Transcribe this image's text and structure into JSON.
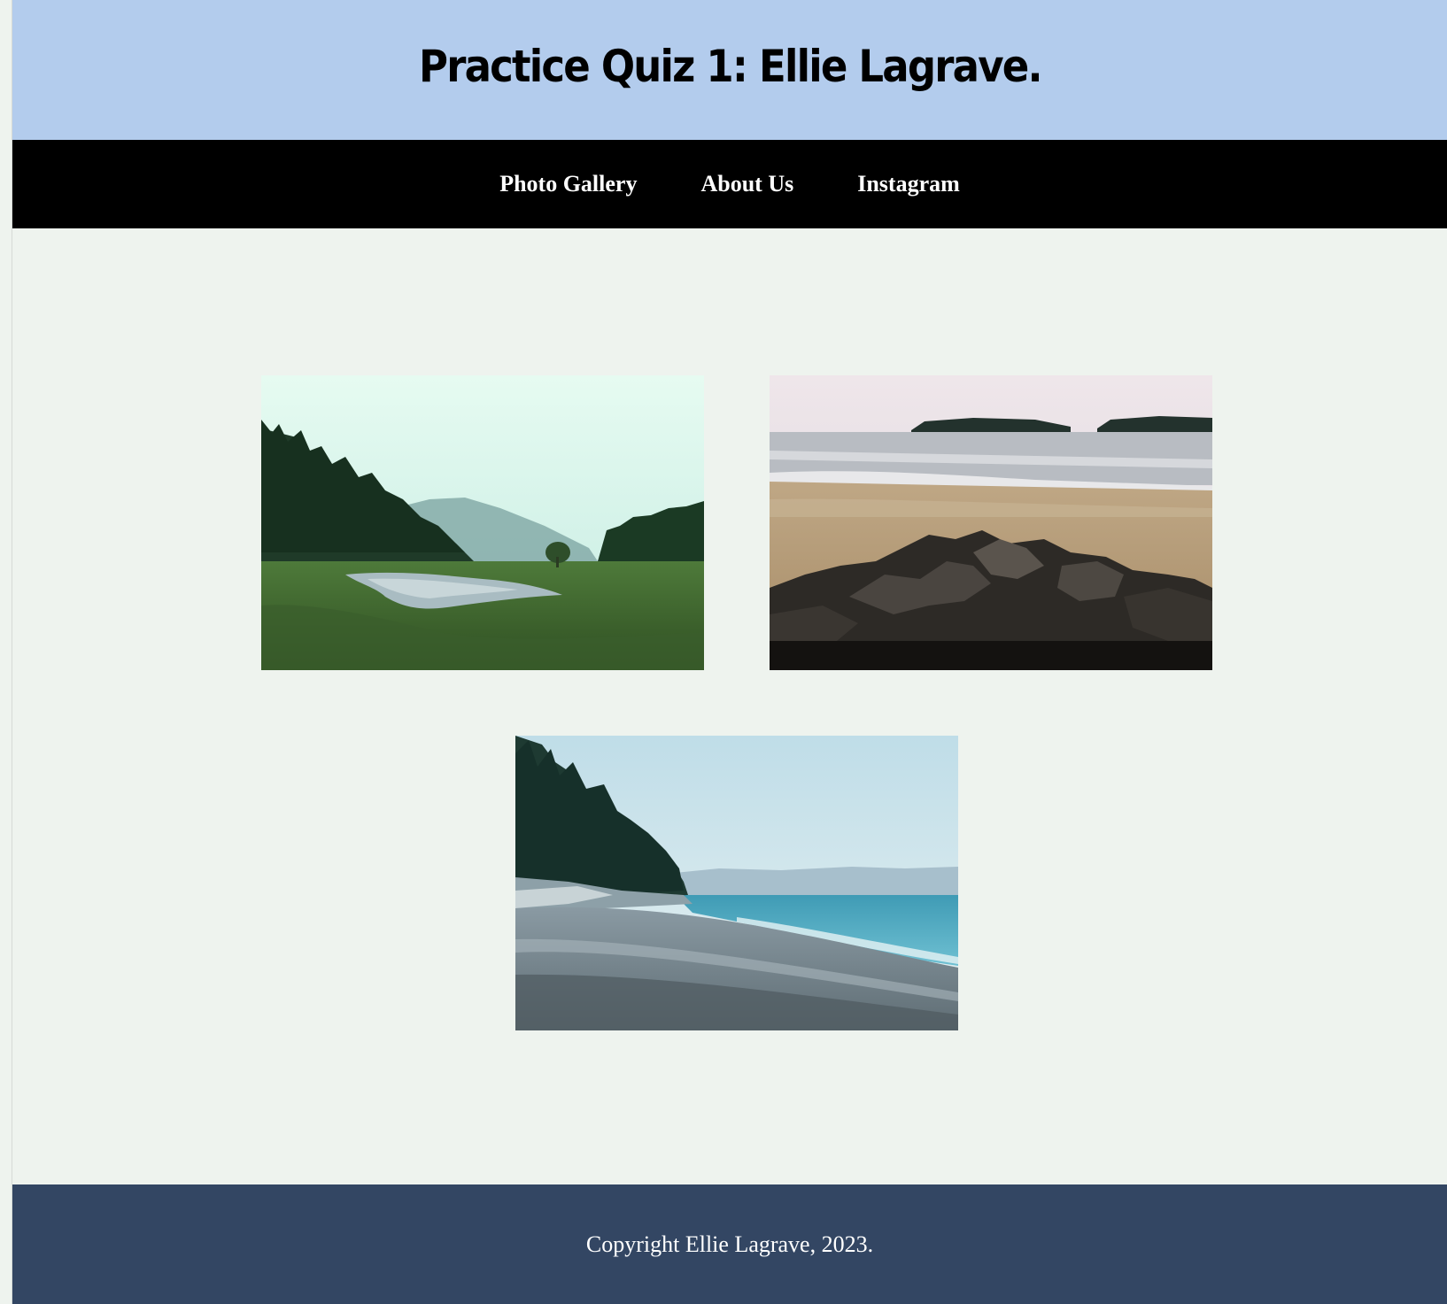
{
  "header": {
    "title": "Practice Quiz 1: Ellie Lagrave."
  },
  "nav": {
    "items": [
      {
        "label": "Photo Gallery"
      },
      {
        "label": "About Us"
      },
      {
        "label": "Instagram"
      }
    ]
  },
  "gallery": {
    "photos": [
      {
        "subject": "forest valley with river"
      },
      {
        "subject": "sandy beach with rocks and islands"
      },
      {
        "subject": "pebble beach with evergreens and sea"
      }
    ]
  },
  "footer": {
    "copyright": "Copyright Ellie Lagrave, 2023."
  },
  "colors": {
    "header_bg": "#b3cced",
    "nav_bg": "#000000",
    "page_bg": "#eef3ee",
    "footer_bg": "#334663"
  }
}
